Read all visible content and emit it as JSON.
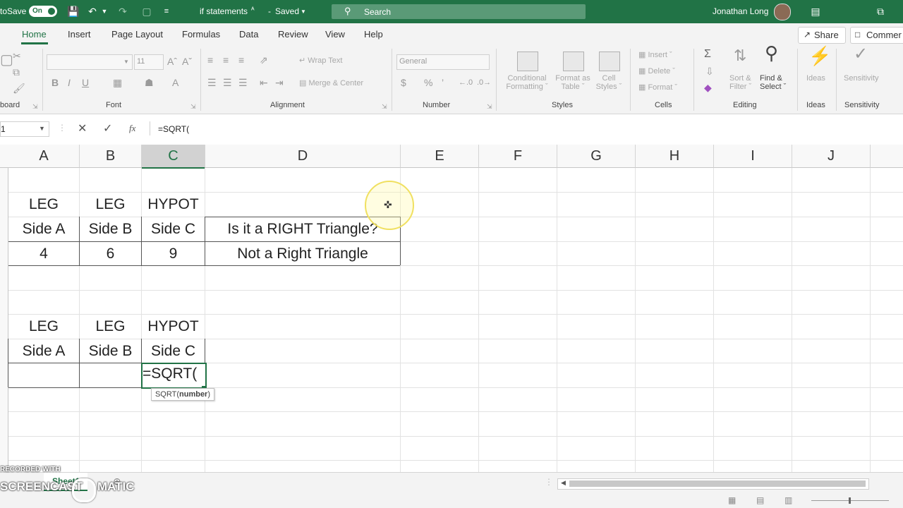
{
  "titlebar": {
    "autosave_label": "toSave",
    "autosave_state": "On",
    "doc_title": "if statements",
    "save_status": "Saved",
    "search_placeholder": "Search",
    "user_name": "Jonathan Long"
  },
  "ribbon_tabs": [
    "Home",
    "Insert",
    "Page Layout",
    "Formulas",
    "Data",
    "Review",
    "View",
    "Help"
  ],
  "share_label": "Share",
  "comments_label": "Commer",
  "ribbon": {
    "clipboard_label": "board",
    "font_label": "Font",
    "font_size": "11",
    "alignment_label": "Alignment",
    "wrap_text": "Wrap Text",
    "merge_center": "Merge & Center",
    "number_label": "Number",
    "number_format": "General",
    "styles_label": "Styles",
    "conditional_formatting": [
      "Conditional",
      "Formatting"
    ],
    "format_as_table": [
      "Format as",
      "Table"
    ],
    "cell_styles": [
      "Cell",
      "Styles"
    ],
    "cells_label": "Cells",
    "insert": "Insert",
    "delete": "Delete",
    "format": "Format",
    "editing_label": "Editing",
    "sort_filter": [
      "Sort &",
      "Filter"
    ],
    "find_select": [
      "Find &",
      "Select"
    ],
    "ideas": "Ideas",
    "ideas_label": "Ideas",
    "sensitivity": "Sensitivity",
    "sensitivity_label": "Sensitivity"
  },
  "formula_bar": {
    "name_box": "1",
    "fx": "fx",
    "formula": "=SQRT("
  },
  "columns": [
    "A",
    "B",
    "C",
    "D",
    "E",
    "F",
    "G",
    "H",
    "I",
    "J"
  ],
  "cells": {
    "r3": {
      "a": "LEG",
      "b": "LEG",
      "c": "HYPOT"
    },
    "r4": {
      "a": "Side A",
      "b": "Side B",
      "c": "Side C",
      "d": "Is it a RIGHT Triangle?"
    },
    "r5": {
      "a": "4",
      "b": "6",
      "c": "9",
      "d": "Not a Right Triangle"
    },
    "r8": {
      "a": "LEG",
      "b": "LEG",
      "c": "HYPOT"
    },
    "r9": {
      "a": "Side A",
      "b": "Side B",
      "c": "Side C"
    },
    "r10": {
      "c": "=SQRT("
    }
  },
  "tooltip": {
    "fn": "SQRT(",
    "arg": "number",
    ")": ")"
  },
  "sheet_tab": "Sheet1",
  "watermark": {
    "line1": "RECORDED WITH",
    "line2": "SCREENCAST",
    "line3": "MATIC"
  }
}
